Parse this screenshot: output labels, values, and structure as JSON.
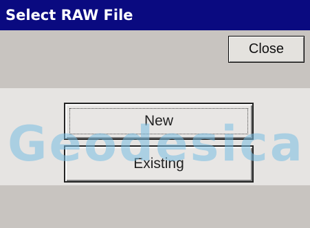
{
  "window": {
    "title": "Select RAW File"
  },
  "toolbar": {
    "close_label": "Close"
  },
  "actions": {
    "new_label": "New",
    "existing_label": "Existing"
  },
  "watermark": {
    "text": "Geodesica"
  }
}
